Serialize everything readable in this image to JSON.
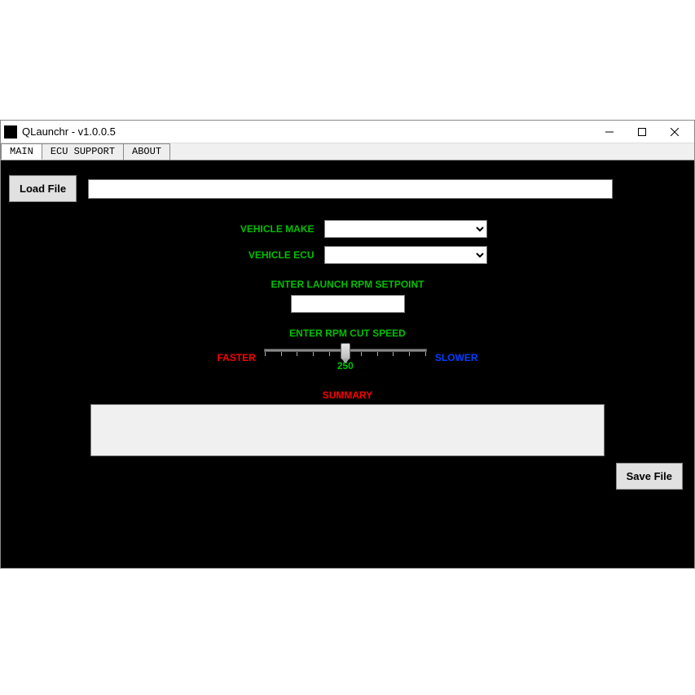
{
  "window": {
    "title": "QLaunchr - v1.0.0.5"
  },
  "tabs": {
    "main": "MAIN",
    "ecu": "ECU SUPPORT",
    "about": "ABOUT"
  },
  "buttons": {
    "load": "Load File",
    "save": "Save File"
  },
  "labels": {
    "vehicle_make": "VEHICLE MAKE",
    "vehicle_ecu": "VEHICLE ECU",
    "launch_setpoint": "ENTER LAUNCH RPM SETPOINT",
    "cut_speed": "ENTER RPM CUT SPEED",
    "faster": "FASTER",
    "slower": "SLOWER",
    "summary": "SUMMARY"
  },
  "values": {
    "file_path": "",
    "vehicle_make": "",
    "vehicle_ecu": "",
    "launch_rpm": "",
    "cut_speed": "250",
    "summary_text": ""
  }
}
